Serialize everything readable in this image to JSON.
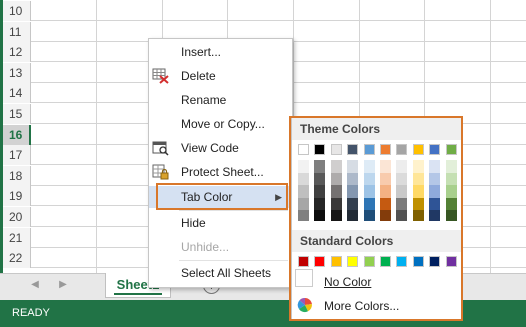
{
  "grid": {
    "rows": [
      "10",
      "11",
      "12",
      "13",
      "14",
      "15",
      "16",
      "17",
      "18",
      "19",
      "20",
      "21",
      "22"
    ],
    "active_row": "16"
  },
  "tabbar": {
    "prev_icon": "◀",
    "next_icon": "▶",
    "sheet_name": "Sheet1",
    "add_icon": "+"
  },
  "status": {
    "text": "READY"
  },
  "menu": {
    "items": [
      {
        "label": "Insert...",
        "icon": "none"
      },
      {
        "label": "Delete",
        "icon": "delete-sheet-icon"
      },
      {
        "label": "Rename",
        "icon": "none"
      },
      {
        "label": "Move or Copy...",
        "icon": "none"
      },
      {
        "label": "View Code",
        "icon": "view-code-icon"
      },
      {
        "label": "Protect Sheet...",
        "icon": "protect-sheet-icon"
      },
      {
        "label": "Tab Color",
        "icon": "none",
        "submenu_arrow": "▶"
      },
      {
        "label": "Hide",
        "icon": "none"
      },
      {
        "label": "Unhide...",
        "icon": "none",
        "disabled": true
      },
      {
        "label": "Select All Sheets",
        "icon": "none"
      }
    ]
  },
  "palette": {
    "theme_title": "Theme Colors",
    "standard_title": "Standard Colors",
    "no_color": "No Color",
    "more_colors": "More Colors...",
    "theme_colors": [
      [
        "#FFFFFF",
        "#F2F2F2",
        "#D9D9D9",
        "#BFBFBF",
        "#A6A6A6",
        "#808080"
      ],
      [
        "#000000",
        "#7F7F7F",
        "#595959",
        "#404040",
        "#262626",
        "#0D0D0D"
      ],
      [
        "#E7E6E6",
        "#D0CECE",
        "#AEABAB",
        "#757171",
        "#3A3838",
        "#171616"
      ],
      [
        "#44546A",
        "#D6DCE4",
        "#ADB9CA",
        "#8497B0",
        "#333F4F",
        "#222A35"
      ],
      [
        "#5B9BD5",
        "#DEEBF6",
        "#BDD7EE",
        "#9DC3E6",
        "#2E75B5",
        "#1F4E79"
      ],
      [
        "#ED7D31",
        "#FBE5D5",
        "#F8CBAD",
        "#F4B183",
        "#C55A11",
        "#833C0B"
      ],
      [
        "#A5A5A5",
        "#EDEDED",
        "#DBDBDB",
        "#C9C9C9",
        "#7B7B7B",
        "#525252"
      ],
      [
        "#FFC000",
        "#FFF2CC",
        "#FFE699",
        "#FFD965",
        "#BF9000",
        "#7F6000"
      ],
      [
        "#4472C4",
        "#DAE3F3",
        "#B4C7E7",
        "#8FAADC",
        "#2F5496",
        "#203864"
      ],
      [
        "#70AD47",
        "#E2EFD9",
        "#C5E0B3",
        "#A8D08D",
        "#538135",
        "#375623"
      ]
    ],
    "standard_colors": [
      "#C00000",
      "#FF0000",
      "#FFC000",
      "#FFFF00",
      "#92D050",
      "#00B050",
      "#00B0F0",
      "#0070C0",
      "#002060",
      "#7030A0"
    ]
  }
}
